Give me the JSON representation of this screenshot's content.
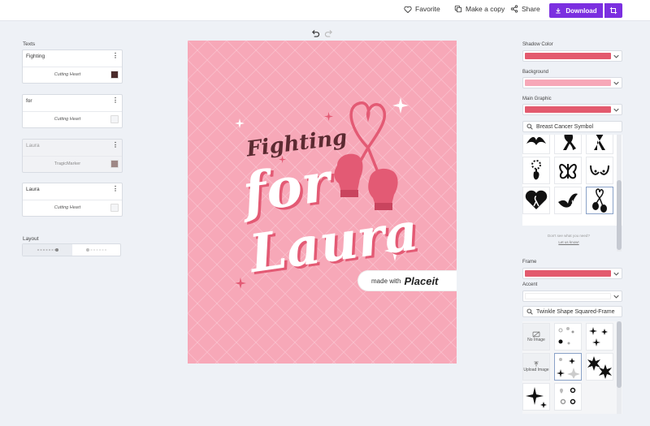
{
  "topbar": {
    "favorite": "Favorite",
    "make_copy": "Make a copy",
    "share": "Share",
    "download": "Download"
  },
  "left_panel": {
    "texts_title": "Texts",
    "text_items": [
      {
        "value": "Fighting",
        "font": "Cutting Heart",
        "color": "#4a2b2b",
        "disabled": false
      },
      {
        "value": "for",
        "font": "Cutting Heart",
        "color": "#f4f5f7",
        "disabled": false
      },
      {
        "value": "Laura",
        "font": "TragicMarker",
        "color": "#9e8886",
        "disabled": true
      },
      {
        "value": "Laura",
        "font": "Cutting Heart",
        "color": "#f4f5f7",
        "disabled": false
      }
    ],
    "layout_title": "Layout"
  },
  "canvas": {
    "line1": "Fighting",
    "line2": "for",
    "line3": "Laura",
    "watermark_prefix": "made with",
    "watermark_brand": "Placeit",
    "bg_color": "#f7a8b8",
    "accent_color": "#e35a74"
  },
  "right_panel": {
    "shadow_color_label": "Shadow Color",
    "shadow_color": "#e35a6e",
    "background_label": "Background",
    "background_color": "#f7a8b8",
    "main_graphic_label": "Main Graphic",
    "main_graphic_color": "#e35a6e",
    "graphic_search": "Breast Cancer Symbol",
    "help_text": "Don't see what you need?",
    "help_link": "Let us know!",
    "frame_label": "Frame",
    "frame_color": "#e35a6e",
    "accent_label": "Accent",
    "accent_color": "#ffffff",
    "accent_search": "Twinkle Shape Squared-Frame",
    "no_image": "No Image",
    "upload_image": "Upload Image"
  }
}
